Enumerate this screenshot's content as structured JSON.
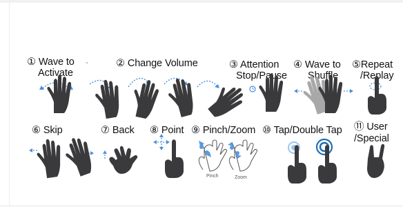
{
  "colors": {
    "hand": "#3a3a3c",
    "hand_light": "#9a9a9a",
    "arrow": "#4a90d9",
    "ring": "#1f6fb4"
  },
  "gestures": [
    {
      "line1": "① Wave to",
      "line2": "Activate"
    },
    {
      "line1": "② Change Volume"
    },
    {
      "line1": "③ Attention",
      "line2": "Stop/Pause"
    },
    {
      "line1": "④ Wave to",
      "line2": "Shuffle"
    },
    {
      "line1": "⑤Repeat",
      "line2": "/Replay"
    },
    {
      "line1": "⑥ Skip"
    },
    {
      "line1": "⑦ Back"
    },
    {
      "line1": "⑧ Point"
    },
    {
      "line1": "⑨ Pinch/Zoom"
    },
    {
      "line1": "⑩ Tap/Double Tap"
    },
    {
      "line1": "⑪ User",
      "line2": "/Special"
    }
  ],
  "captions": {
    "pinch": "Pinch",
    "zoom": "Zoom"
  },
  "icons": [
    "open-hand-icon",
    "curved-arrow-icon",
    "clock-icon",
    "pointing-hand-icon",
    "pinch-hand-icon",
    "tap-ring-icon",
    "horns-hand-icon"
  ]
}
